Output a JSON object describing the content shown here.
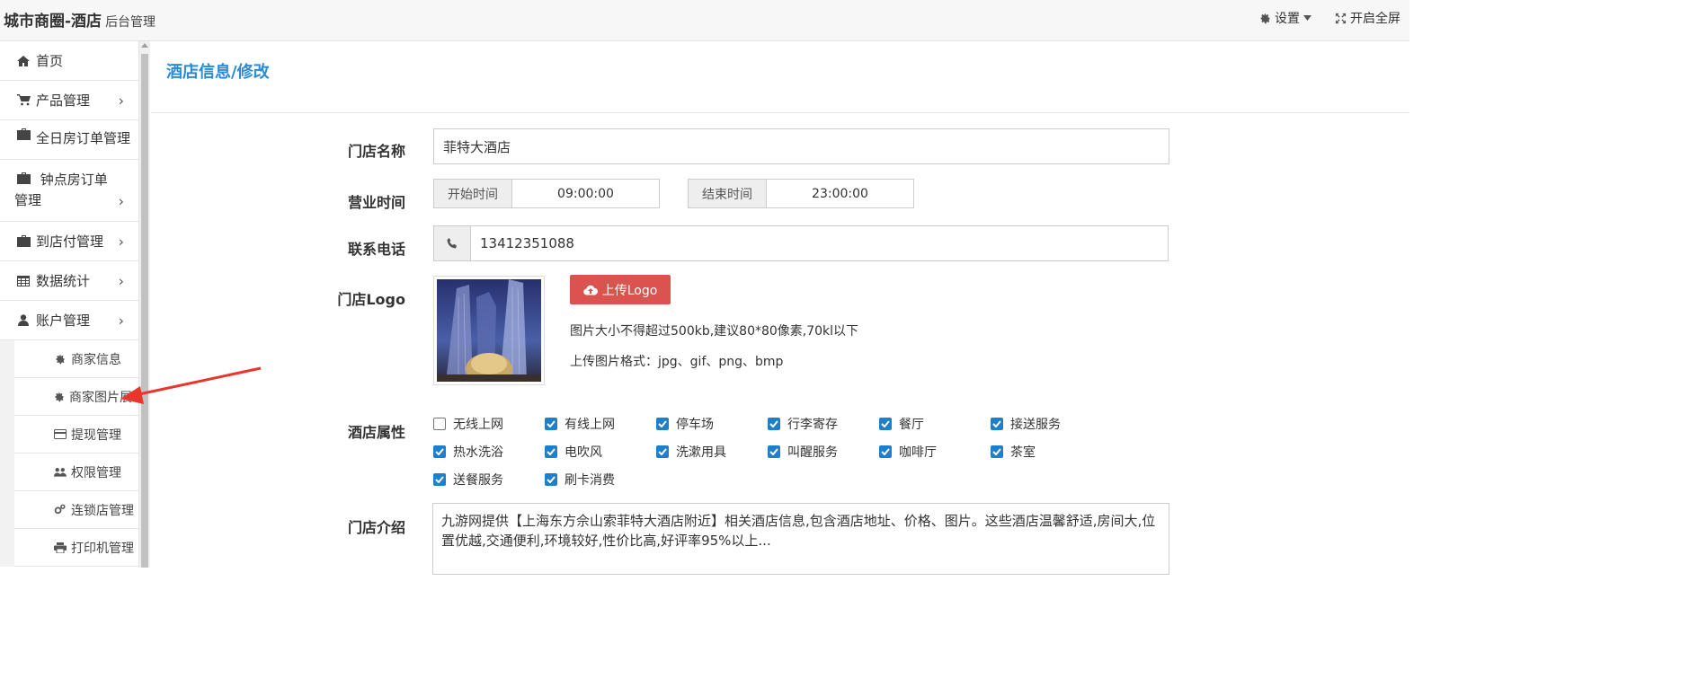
{
  "header": {
    "brand": "城市商圈-酒店",
    "subtitle": "后台管理",
    "settings_label": "设置",
    "fullscreen_label": "开启全屏"
  },
  "sidebar": {
    "items": [
      {
        "label": "首页"
      },
      {
        "label": "产品管理"
      },
      {
        "label": "全日房订单管理"
      },
      {
        "label_line1": "钟点房订单",
        "label_line2": "管理"
      },
      {
        "label": "到店付管理"
      },
      {
        "label": "数据统计"
      },
      {
        "label": "账户管理"
      }
    ],
    "sub_items": [
      {
        "label": "商家信息"
      },
      {
        "label": "商家图片展示"
      },
      {
        "label": "提现管理"
      },
      {
        "label": "权限管理"
      },
      {
        "label": "连锁店管理"
      },
      {
        "label": "打印机管理"
      }
    ]
  },
  "page": {
    "title": "酒店信息/修改"
  },
  "form": {
    "name_label": "门店名称",
    "name_value": "菲特大酒店",
    "hours_label": "营业时间",
    "start_label": "开始时间",
    "start_value": "09:00:00",
    "end_label": "结束时间",
    "end_value": "23:00:00",
    "phone_label": "联系电话",
    "phone_value": "13412351088",
    "logo_label": "门店Logo",
    "upload_label": "上传Logo",
    "hint_size": "图片大小不得超过500kb,建议80*80像素,70kl以下",
    "hint_format": "上传图片格式：jpg、gif、png、bmp",
    "attr_label": "酒店属性",
    "attributes": [
      {
        "label": "无线上网",
        "checked": false
      },
      {
        "label": "有线上网",
        "checked": true
      },
      {
        "label": "停车场",
        "checked": true
      },
      {
        "label": "行李寄存",
        "checked": true
      },
      {
        "label": "餐厅",
        "checked": true
      },
      {
        "label": "接送服务",
        "checked": true
      },
      {
        "label": "热水洗浴",
        "checked": true
      },
      {
        "label": "电吹风",
        "checked": true
      },
      {
        "label": "洗漱用具",
        "checked": true
      },
      {
        "label": "叫醒服务",
        "checked": true
      },
      {
        "label": "咖啡厅",
        "checked": true
      },
      {
        "label": "茶室",
        "checked": true
      },
      {
        "label": "送餐服务",
        "checked": true
      },
      {
        "label": "刷卡消费",
        "checked": true
      }
    ],
    "intro_label": "门店介绍",
    "intro_value": "九游网提供【上海东方佘山索菲特大酒店附近】相关酒店信息,包含酒店地址、价格、图片。这些酒店温馨舒适,房间大,位置优越,交通便利,环境较好,性价比高,好评率95%以上..."
  },
  "colors": {
    "accent": "#2a8cd6",
    "upload_button": "#d9534f",
    "checkbox": "#1f7fc9",
    "arrow": "#e8362d"
  }
}
